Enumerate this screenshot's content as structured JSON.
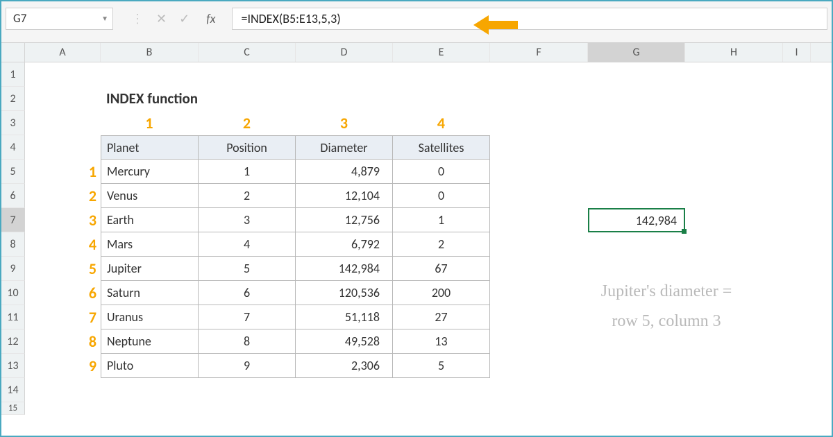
{
  "name_box": "G7",
  "formula": "=INDEX(B5:E13,5,3)",
  "columns": [
    "A",
    "B",
    "C",
    "D",
    "E",
    "F",
    "G",
    "H",
    "I"
  ],
  "rows": [
    "1",
    "2",
    "3",
    "4",
    "5",
    "6",
    "7",
    "8",
    "9",
    "10",
    "11",
    "12",
    "13",
    "14",
    "15"
  ],
  "title": "INDEX function",
  "col_nums": [
    "1",
    "2",
    "3",
    "4"
  ],
  "row_nums": [
    "1",
    "2",
    "3",
    "4",
    "5",
    "6",
    "7",
    "8",
    "9"
  ],
  "headers": {
    "planet": "Planet",
    "position": "Position",
    "diameter": "Diameter",
    "satellites": "Satellites"
  },
  "planets": [
    {
      "name": "Mercury",
      "pos": "1",
      "dia": "4,879",
      "sat": "0"
    },
    {
      "name": "Venus",
      "pos": "2",
      "dia": "12,104",
      "sat": "0"
    },
    {
      "name": "Earth",
      "pos": "3",
      "dia": "12,756",
      "sat": "1"
    },
    {
      "name": "Mars",
      "pos": "4",
      "dia": "6,792",
      "sat": "2"
    },
    {
      "name": "Jupiter",
      "pos": "5",
      "dia": "142,984",
      "sat": "67"
    },
    {
      "name": "Saturn",
      "pos": "6",
      "dia": "120,536",
      "sat": "200"
    },
    {
      "name": "Uranus",
      "pos": "7",
      "dia": "51,118",
      "sat": "27"
    },
    {
      "name": "Neptune",
      "pos": "8",
      "dia": "49,528",
      "sat": "13"
    },
    {
      "name": "Pluto",
      "pos": "9",
      "dia": "2,306",
      "sat": "5"
    }
  ],
  "result": "142,984",
  "annotation_l1": "Jupiter's diameter =",
  "annotation_l2": "row 5, column 3"
}
